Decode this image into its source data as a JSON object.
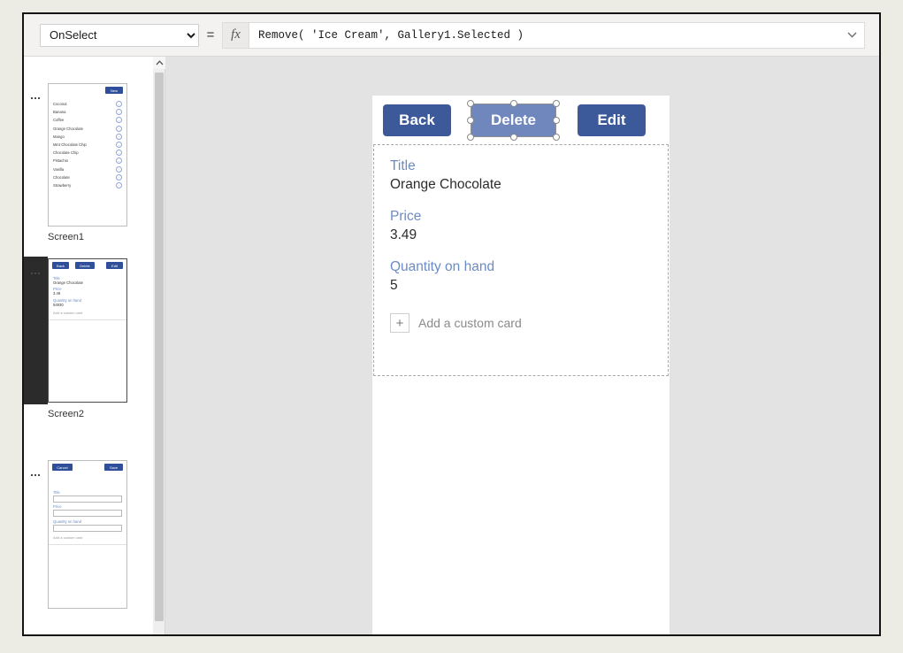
{
  "formula_bar": {
    "property": "OnSelect",
    "property_options": [
      "OnSelect"
    ],
    "equals": "=",
    "fx_label": "fx",
    "formula": "Remove( 'Ice Cream', Gallery1.Selected )",
    "formula_placeholder": "",
    "expand_icon": "chevron-down-icon",
    "dropdown_icon": "chevron-down-icon"
  },
  "screen_rail": {
    "menu_icon": "ellipsis-icon",
    "scroll_up_icon": "chevron-up-icon",
    "screens": [
      {
        "name": "Screen1",
        "selected": false,
        "type": "gallery",
        "toolbar_buttons": [
          "New"
        ],
        "items": [
          "Coconut",
          "Banana",
          "Coffee",
          "Orange Chocolate",
          "Mango",
          "Mint Chocolate Chip",
          "Chocolate Chip",
          "Pistachio",
          "Vanilla",
          "Chocolate",
          "Strawberry"
        ],
        "item_icon": "chevron-right-icon"
      },
      {
        "name": "Screen2",
        "selected": true,
        "type": "detail",
        "toolbar_buttons": [
          "Back",
          "Delete",
          "Edit"
        ],
        "fields": [
          {
            "label": "Title",
            "value": "Orange Chocolate"
          },
          {
            "label": "Price",
            "value": "3.49"
          },
          {
            "label": "Quantity on hand",
            "value": "54930"
          }
        ],
        "add_card_label": "Add a custom card",
        "add_card_icon": "plus-icon"
      },
      {
        "name": "Screen3",
        "selected": false,
        "type": "edit",
        "toolbar_buttons": [
          "Cancel",
          "Save"
        ],
        "fields": [
          {
            "label": "Title",
            "value": ""
          },
          {
            "label": "Price",
            "value": ""
          },
          {
            "label": "Quantity on hand",
            "value": ""
          }
        ],
        "add_card_label": "Add a custom card",
        "add_card_icon": "plus-icon"
      }
    ]
  },
  "canvas": {
    "toolbar": {
      "back_label": "Back",
      "delete_label": "Delete",
      "edit_label": "Edit",
      "selected_control": "Delete"
    },
    "form": {
      "fields": [
        {
          "label": "Title",
          "value": "Orange Chocolate"
        },
        {
          "label": "Price",
          "value": "3.49"
        },
        {
          "label": "Quantity on hand",
          "value": "5"
        }
      ],
      "add_card_label": "Add a custom card",
      "add_card_icon": "plus-icon"
    }
  },
  "colors": {
    "page_background": "#edece4",
    "app_background": "#e3e3e3",
    "button_primary": "#3c5a9a",
    "button_selected": "#7087bd",
    "field_label": "#6b8bc4",
    "screen_selected_band": "#2b2b2b",
    "formula_bar_background": "#f3f2f1"
  }
}
